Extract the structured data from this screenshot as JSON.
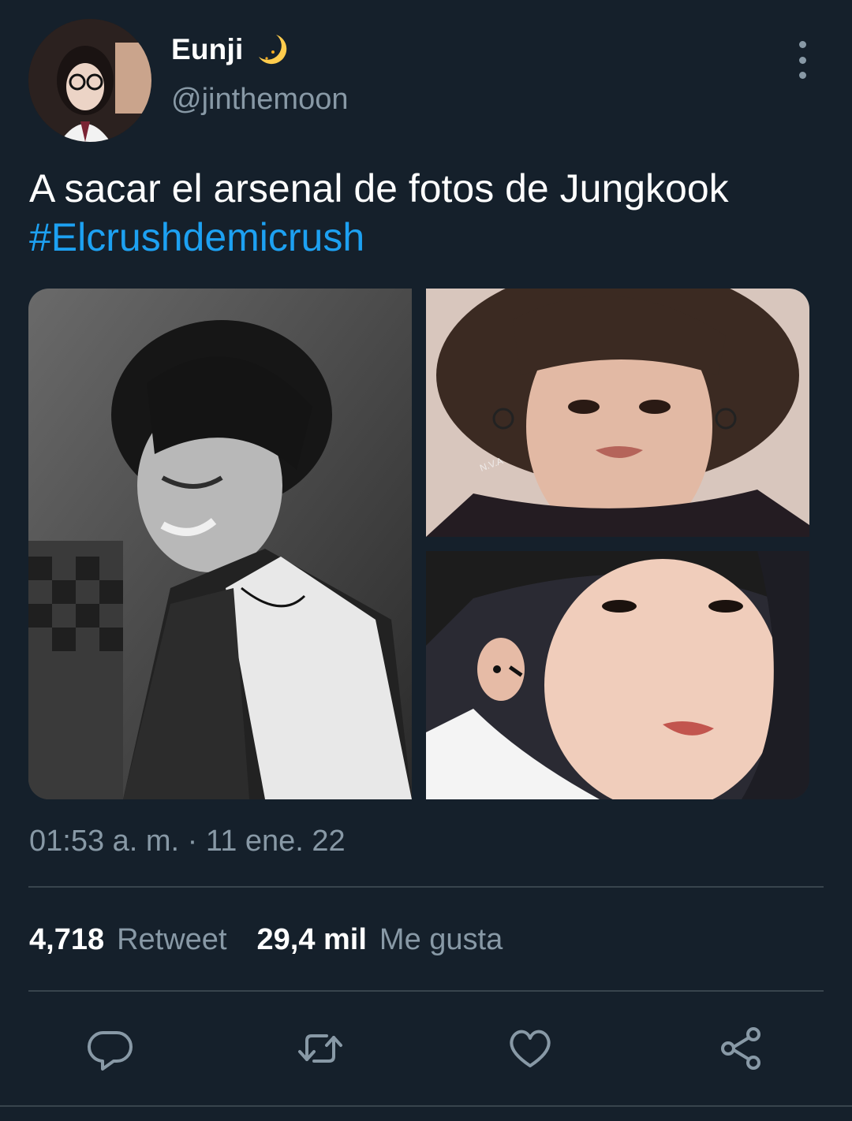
{
  "author": {
    "display_name": "Eunji",
    "emoji": "crescent-moon",
    "handle": "@jinthemoon"
  },
  "tweet": {
    "text": "A sacar el arsenal de fotos de Jungkook",
    "hashtag": "#Elcrushdemicrush",
    "timestamp": "01:53 a. m. · 11 ene. 22"
  },
  "stats": {
    "retweets_count": "4,718",
    "retweets_label": "Retweet",
    "likes_count": "29,4 mil",
    "likes_label": "Me gusta"
  },
  "media": {
    "photo_2_watermark": "N.V.A"
  },
  "actions": [
    "reply-icon",
    "retweet-icon",
    "like-icon",
    "share-icon"
  ],
  "colors": {
    "background": "#15202b",
    "text": "#ffffff",
    "secondary": "#8899a6",
    "link": "#1da1f2",
    "divider": "#38444d",
    "moon": "#ffcc4d"
  }
}
